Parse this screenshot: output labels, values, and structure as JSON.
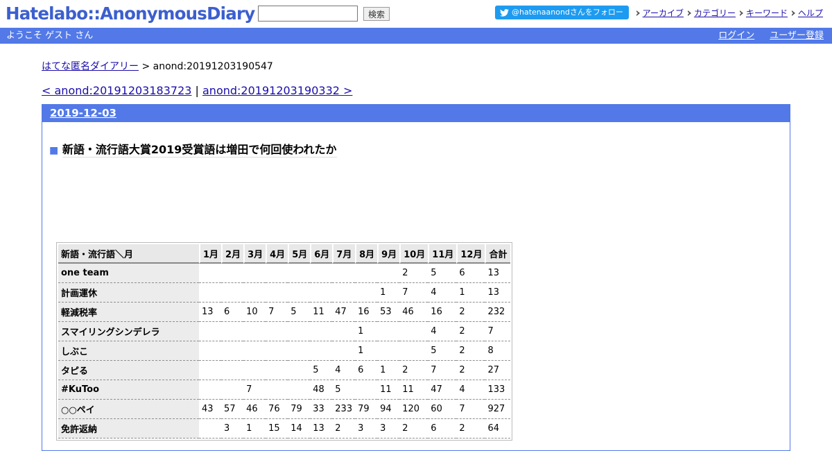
{
  "header": {
    "logo": "Hatelabo::AnonymousDiary",
    "search_value": "",
    "search_button": "検索",
    "follow_button": "@hatenaanondさんをフォロー",
    "links": [
      "アーカイブ",
      "カテゴリー",
      "キーワード",
      "ヘルプ"
    ]
  },
  "bar": {
    "welcome": "ようこそ ゲスト さん",
    "login": "ログイン",
    "register": "ユーザー登録"
  },
  "breadcrumb": {
    "home": "はてな匿名ダイアリー",
    "separator": " > ",
    "current": "anond:20191203190547"
  },
  "pager": {
    "prev": "< anond:20191203183723",
    "separator": " | ",
    "next": "anond:20191203190332 >"
  },
  "day": {
    "date": "2019-12-03",
    "entry_marker": "■",
    "entry_title": "新語・流行語大賞2019受賞語は増田で何回使われたか"
  },
  "table": {
    "headers": [
      "新語・流行語＼月",
      "1月",
      "2月",
      "3月",
      "4月",
      "5月",
      "6月",
      "7月",
      "8月",
      "9月",
      "10月",
      "11月",
      "12月",
      "合計"
    ],
    "rows": [
      {
        "label": "one team",
        "cells": [
          "",
          "",
          "",
          "",
          "",
          "",
          "",
          "",
          "",
          "2",
          "5",
          "6",
          "13"
        ]
      },
      {
        "label": "計画運休",
        "cells": [
          "",
          "",
          "",
          "",
          "",
          "",
          "",
          "",
          "1",
          "7",
          "4",
          "1",
          "13"
        ]
      },
      {
        "label": "軽減税率",
        "cells": [
          "13",
          "6",
          "10",
          "7",
          "5",
          "11",
          "47",
          "16",
          "53",
          "46",
          "16",
          "2",
          "232"
        ]
      },
      {
        "label": "スマイリングシンデレラ",
        "cells": [
          "",
          "",
          "",
          "",
          "",
          "",
          "",
          "1",
          "",
          "",
          "4",
          "2",
          "7"
        ]
      },
      {
        "label": "しぶこ",
        "cells": [
          "",
          "",
          "",
          "",
          "",
          "",
          "",
          "1",
          "",
          "",
          "5",
          "2",
          "8"
        ]
      },
      {
        "label": "タピる",
        "cells": [
          "",
          "",
          "",
          "",
          "",
          "5",
          "4",
          "6",
          "1",
          "2",
          "7",
          "2",
          "27"
        ]
      },
      {
        "label": "#KuToo",
        "cells": [
          "",
          "",
          "7",
          "",
          "",
          "48",
          "5",
          "",
          "11",
          "11",
          "47",
          "4",
          "133"
        ]
      },
      {
        "label": "○○ペイ",
        "cells": [
          "43",
          "57",
          "46",
          "76",
          "79",
          "33",
          "233",
          "79",
          "94",
          "120",
          "60",
          "7",
          "927"
        ]
      },
      {
        "label": "免許返納",
        "cells": [
          "",
          "3",
          "1",
          "15",
          "14",
          "13",
          "2",
          "3",
          "3",
          "2",
          "6",
          "2",
          "64"
        ]
      }
    ]
  },
  "colors": {
    "brand_blue": "#5279e7",
    "logo_blue": "#3c5fce",
    "twitter_blue": "#1d9bf0",
    "link": "#1a0dab"
  },
  "icons": {
    "follow": "twitter-bird-icon",
    "nav": "triangle-arrow-icon"
  }
}
